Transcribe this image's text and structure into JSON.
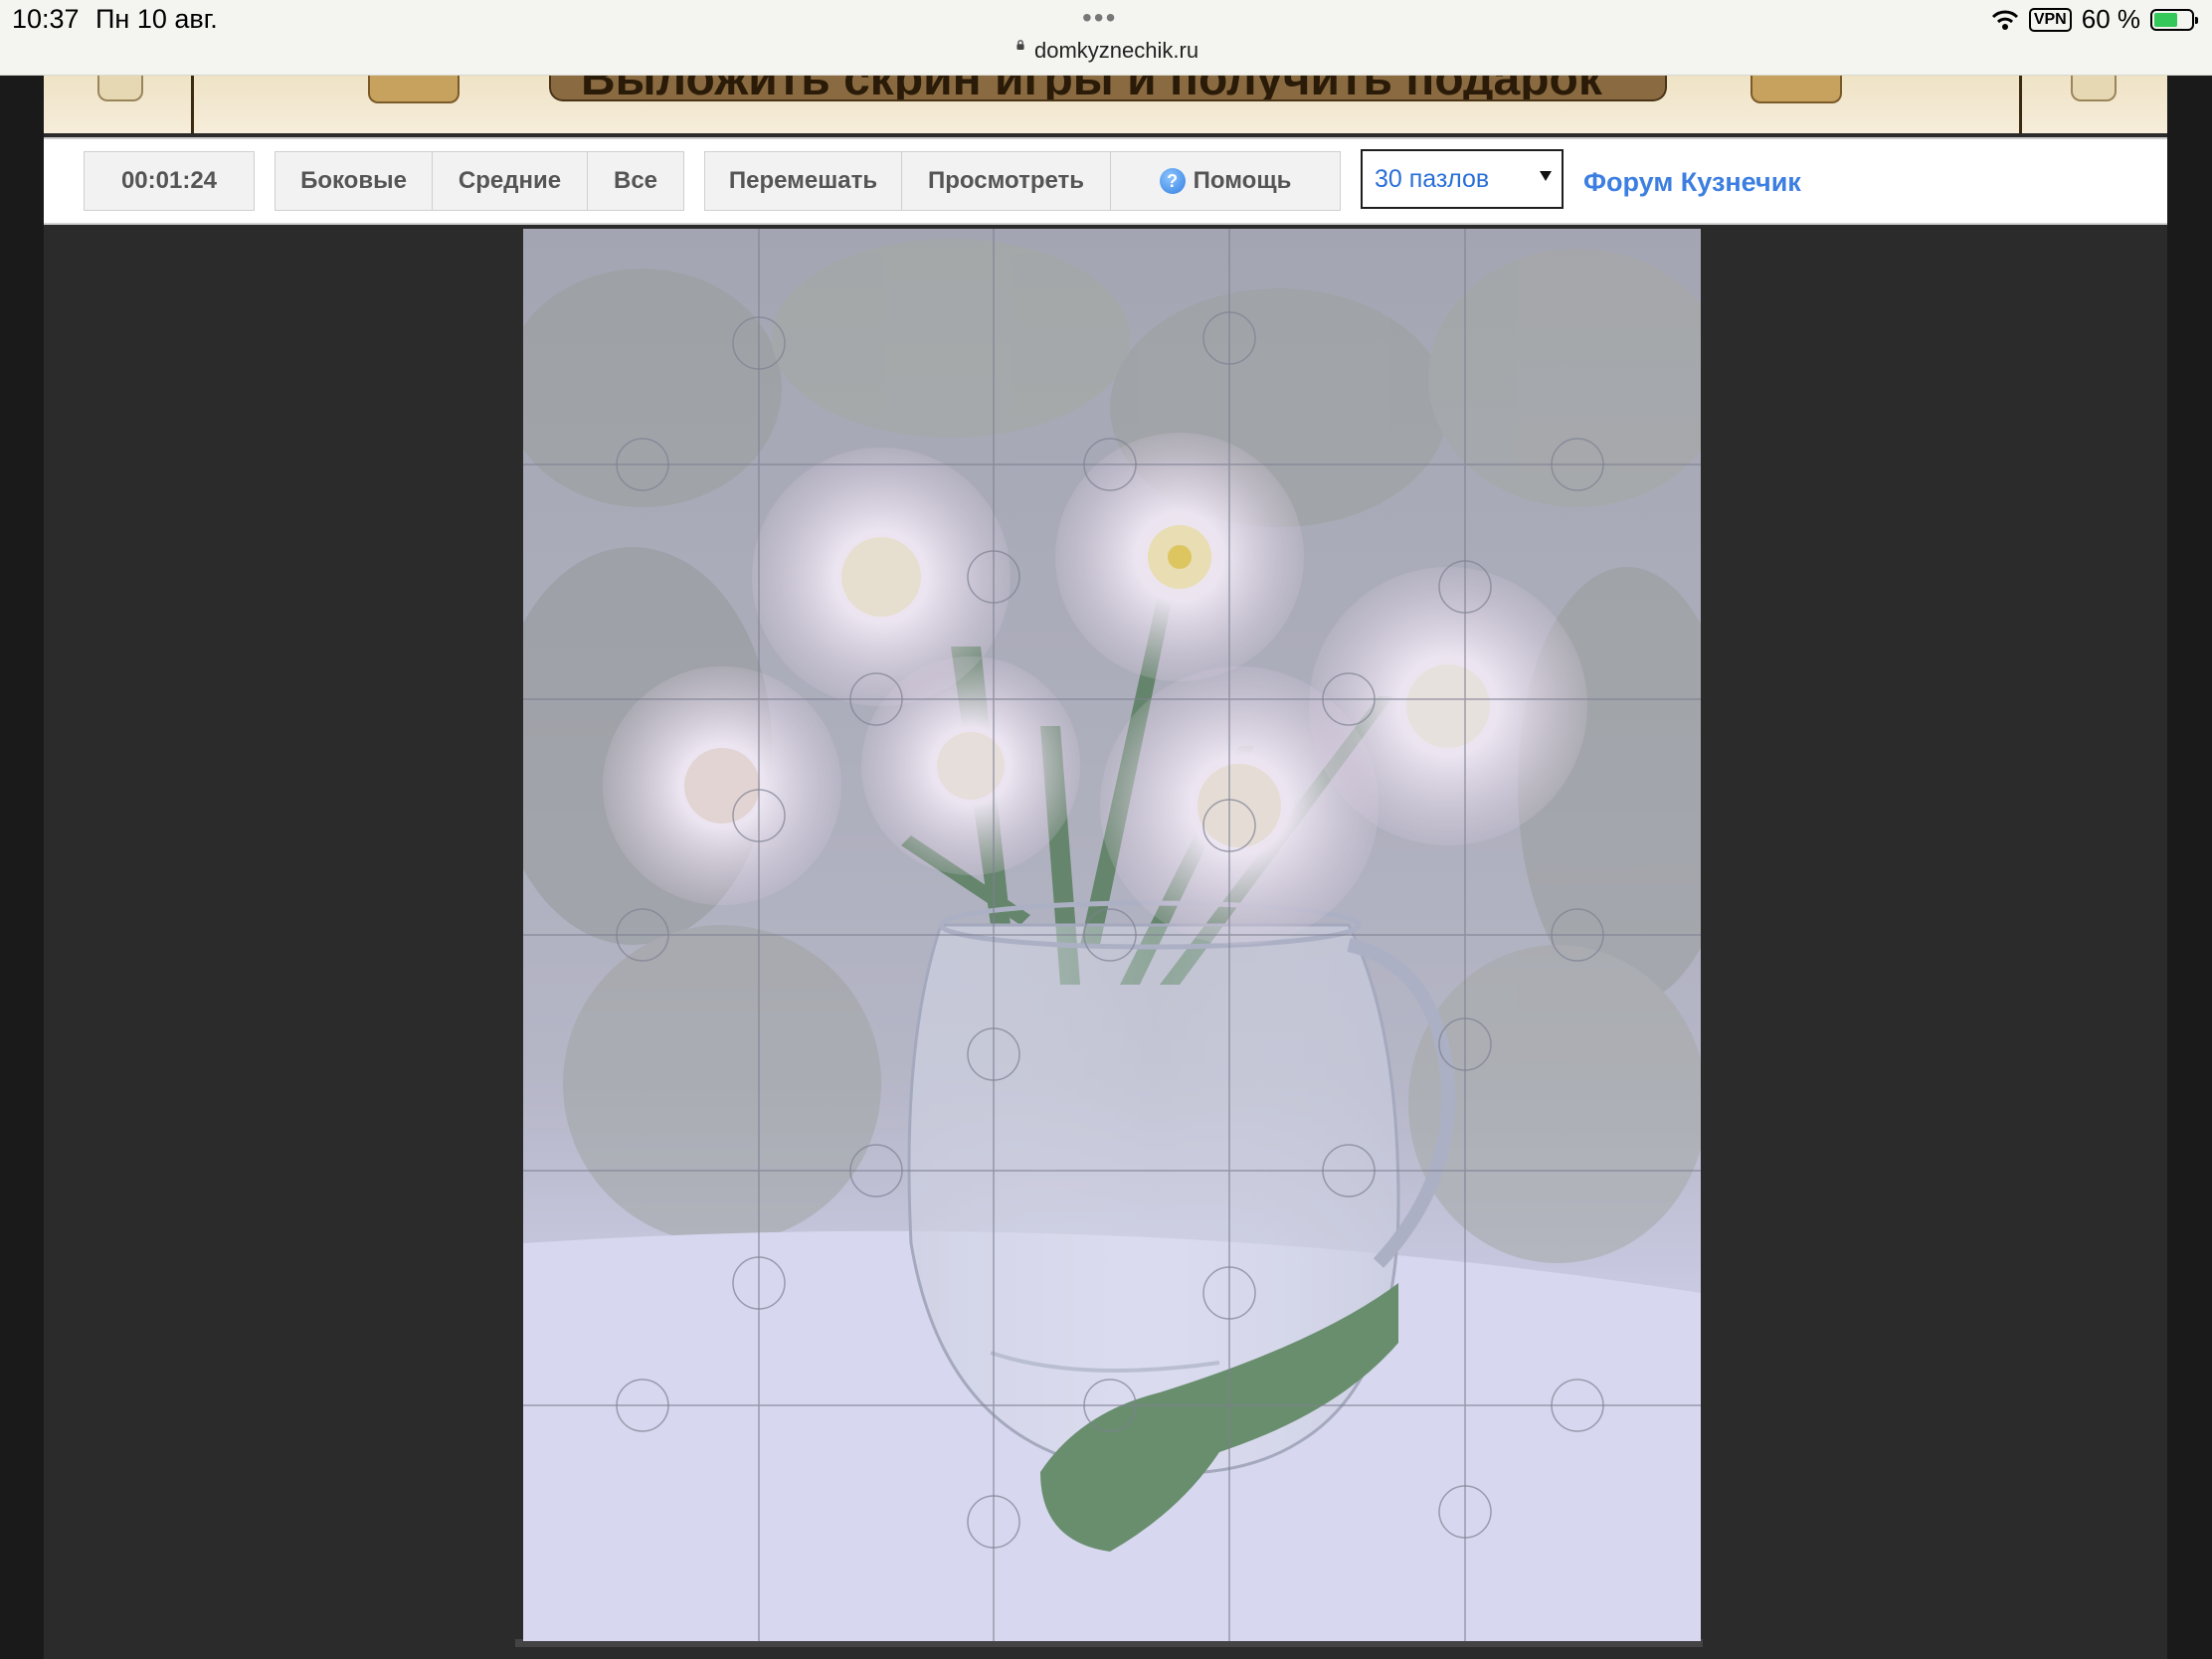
{
  "status_bar": {
    "time": "10:37",
    "date": "Пн 10 авг.",
    "url": "domkyznechik.ru",
    "vpn": "VPN",
    "battery": "60 %",
    "battery_level": 0.6
  },
  "banner": {
    "cta_text": "Выложить скрин игры и получить подарок"
  },
  "toolbar": {
    "timer": "00:01:24",
    "filter_buttons": [
      "Боковые",
      "Средние",
      "Все"
    ],
    "action_buttons": {
      "shuffle": "Перемешать",
      "preview": "Просмотреть",
      "help": "Помощь"
    },
    "help_icon_glyph": "?",
    "pieces_select": "30 пазлов",
    "forum_link": "Форум Кузнечик"
  },
  "puzzle": {
    "columns": 5,
    "rows": 6,
    "piece_count": 30,
    "image": "white asters in glass jug"
  },
  "colors": {
    "link": "#3d7fe0",
    "background": "#2b2b2b",
    "banner": "#f2e7cd"
  }
}
